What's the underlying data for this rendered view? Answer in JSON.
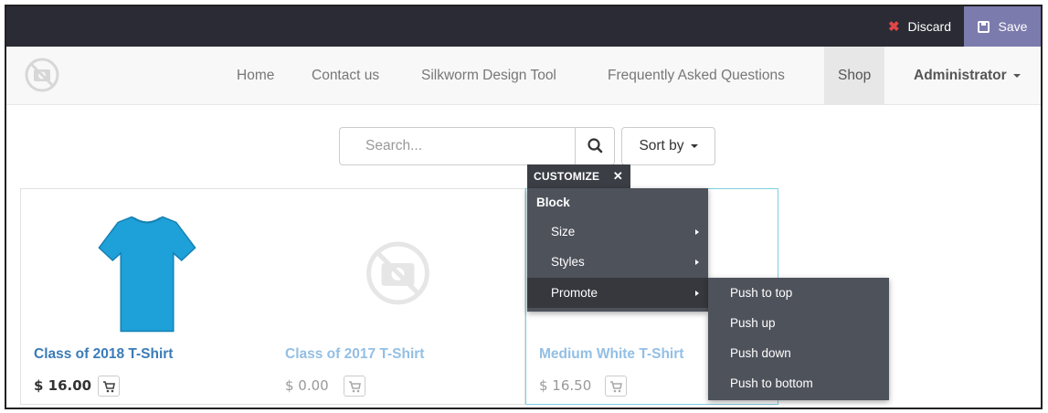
{
  "editor": {
    "discard_label": "Discard",
    "save_label": "Save"
  },
  "nav": {
    "items": [
      "Home",
      "Contact us",
      "Silkworm Design Tool",
      "Frequently Asked Questions",
      "Shop"
    ],
    "user": "Administrator"
  },
  "search": {
    "placeholder": "Search...",
    "sort_label": "Sort by"
  },
  "products": [
    {
      "name": "Class of 2018 T-Shirt",
      "price": "$ 16.00",
      "image": "blue-tshirt"
    },
    {
      "name": "Class of 2017 T-Shirt",
      "price": "$ 0.00",
      "image": "no-image-placeholder"
    },
    {
      "name": "Medium White T-Shirt",
      "price": "$ 16.50",
      "image": "no-image-placeholder"
    }
  ],
  "customize": {
    "tag_label": "CUSTOMIZE",
    "block_label": "Block",
    "items": [
      "Size",
      "Styles",
      "Promote"
    ],
    "submenu": [
      "Push to top",
      "Push up",
      "Push down",
      "Push to bottom"
    ]
  },
  "colors": {
    "editbar": "#2b2b35",
    "save": "#7c7bad",
    "discard_x": "#e34646",
    "link": "#3a7bb8",
    "menu": "#4e525b"
  }
}
